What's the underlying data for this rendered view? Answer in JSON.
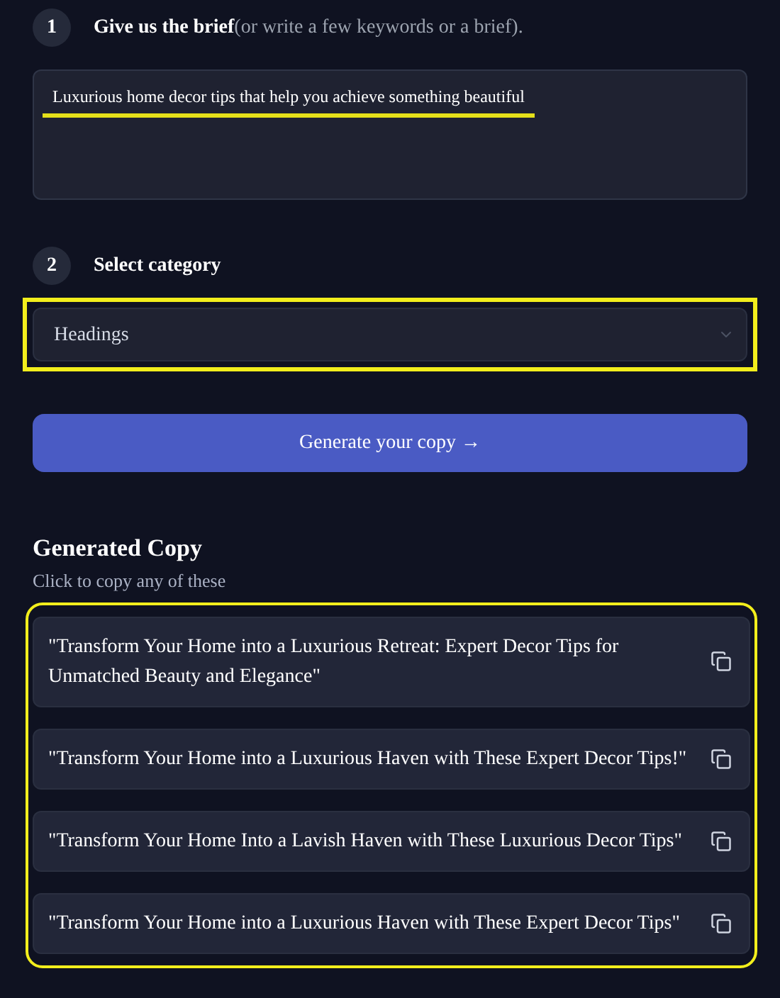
{
  "steps": [
    {
      "number": "1",
      "title": "Give us the brief",
      "hint": "(or write a few keywords or a brief)."
    },
    {
      "number": "2",
      "title": "Select category"
    }
  ],
  "brief": {
    "value": "Luxurious home decor tips that help you achieve something beautiful"
  },
  "category": {
    "value": "Headings"
  },
  "generate_button": "Generate your copy →",
  "results": {
    "title": "Generated Copy",
    "subtitle": "Click to copy any of these",
    "items": [
      {
        "text": "\"Transform Your Home into a Luxurious Retreat: Expert Decor Tips for Unmatched Beauty and Elegance\""
      },
      {
        "text": "\"Transform Your Home into a Luxurious Haven with These Expert Decor Tips!\""
      },
      {
        "text": "\"Transform Your Home Into a Lavish Haven with These Luxurious Decor Tips\""
      },
      {
        "text": "\"Transform Your Home into a Luxurious Haven with These Expert Decor Tips\""
      }
    ]
  }
}
